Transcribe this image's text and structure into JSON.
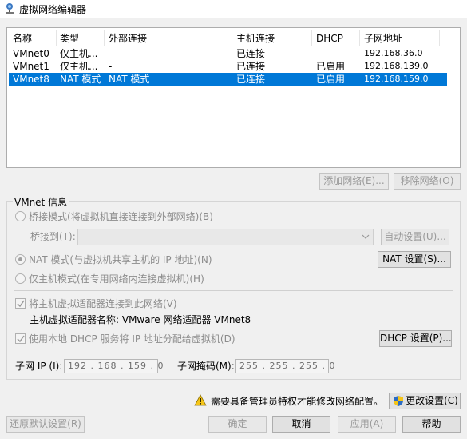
{
  "window": {
    "title": "虚拟网络编辑器"
  },
  "table": {
    "headers": {
      "name": "名称",
      "type": "类型",
      "external": "外部连接",
      "host": "主机连接",
      "dhcp": "DHCP",
      "subnet": "子网地址"
    },
    "rows": [
      {
        "name": "VMnet0",
        "type": "仅主机...",
        "external": "-",
        "host": "已连接",
        "dhcp": "-",
        "subnet": "192.168.36.0"
      },
      {
        "name": "VMnet1",
        "type": "仅主机...",
        "external": "-",
        "host": "已连接",
        "dhcp": "已启用",
        "subnet": "192.168.139.0"
      },
      {
        "name": "VMnet8",
        "type": "NAT 模式",
        "external": "NAT 模式",
        "host": "已连接",
        "dhcp": "已启用",
        "subnet": "192.168.159.0"
      }
    ],
    "selected_index": 2
  },
  "list_buttons": {
    "add": "添加网络(E)...",
    "remove": "移除网络(O)"
  },
  "info": {
    "group_title": "VMnet 信息",
    "bridged_label": "桥接模式(将虚拟机直接连接到外部网络)(B)",
    "bridge_to_label": "桥接到(T):",
    "auto_settings": "自动设置(U)...",
    "nat_label": "NAT 模式(与虚拟机共享主机的 IP 地址)(N)",
    "nat_settings": "NAT 设置(S)...",
    "hostonly_label": "仅主机模式(在专用网络内连接虚拟机)(H)",
    "connect_adapter_label": "将主机虚拟适配器连接到此网络(V)",
    "adapter_name_label": "主机虚拟适配器名称: VMware 网络适配器 VMnet8",
    "dhcp_label": "使用本地 DHCP 服务将 IP 地址分配给虚拟机(D)",
    "dhcp_settings": "DHCP 设置(P)...",
    "subnet_ip_label": "子网 IP (I):",
    "subnet_ip_value": "192 . 168 . 159 .  0",
    "subnet_mask_label": "子网掩码(M):",
    "subnet_mask_value": "255 . 255 . 255 .  0"
  },
  "admin": {
    "warning": "需要具备管理员特权才能修改网络配置。",
    "change_settings": "更改设置(C)"
  },
  "footer": {
    "restore": "还原默认设置(R)",
    "ok": "确定",
    "cancel": "取消",
    "apply": "应用(A)",
    "help": "帮助"
  },
  "colors": {
    "selection": "#0078d7",
    "warning": "#f5c518"
  }
}
